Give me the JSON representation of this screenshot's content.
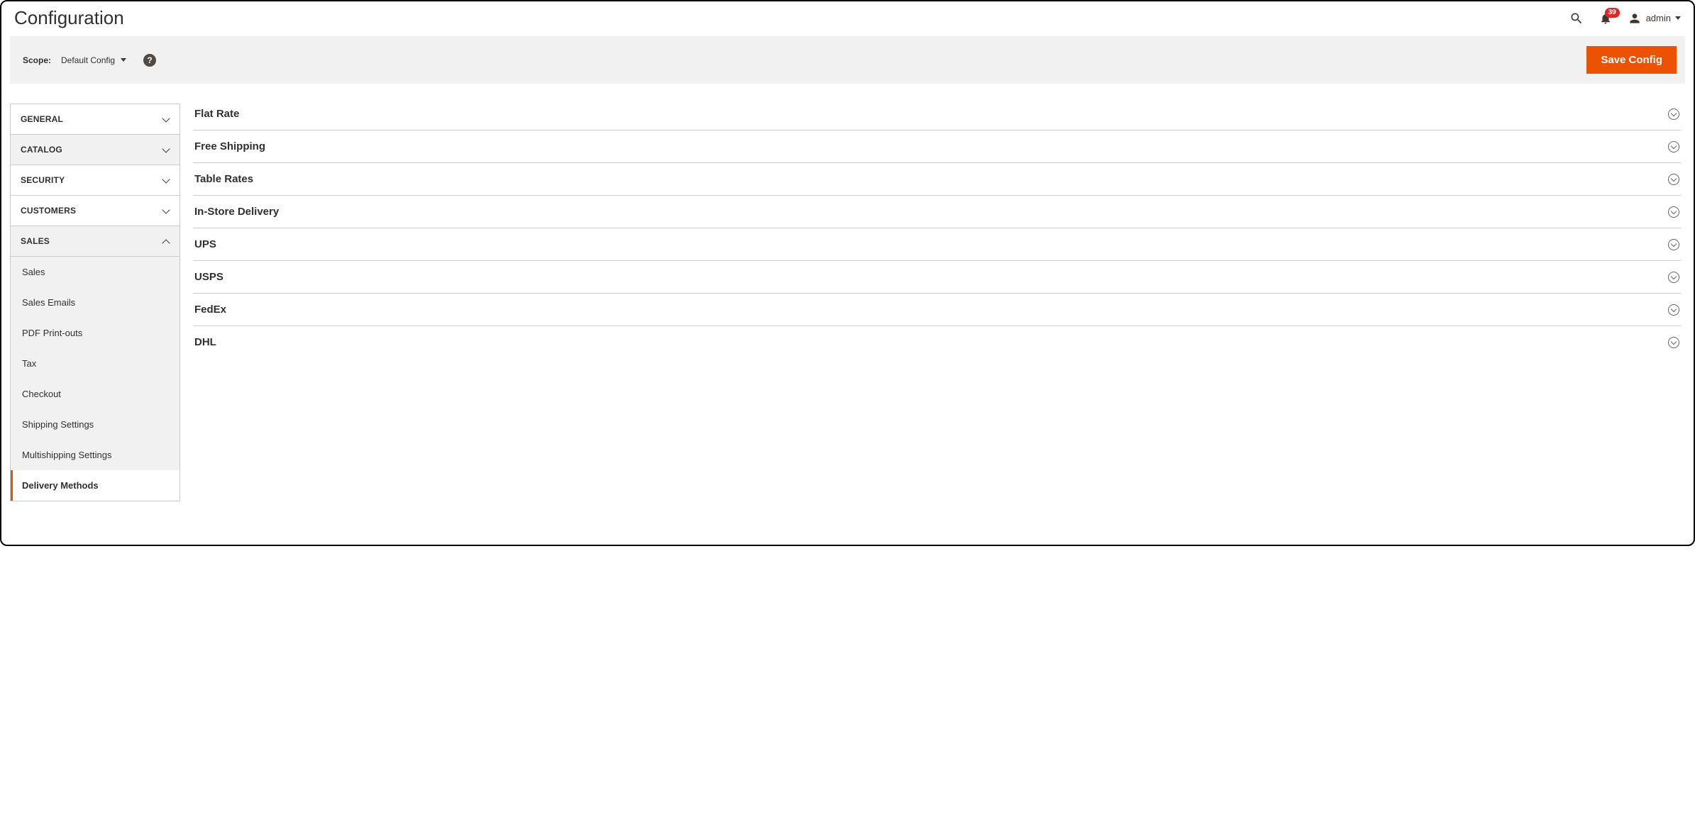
{
  "page": {
    "title": "Configuration"
  },
  "header": {
    "notification_count": "39",
    "user_name": "admin"
  },
  "scope": {
    "label": "Scope:",
    "selected": "Default Config",
    "save_label": "Save Config"
  },
  "sidebar": {
    "tabs": [
      {
        "label": "GENERAL",
        "expanded": false,
        "shaded": false
      },
      {
        "label": "CATALOG",
        "expanded": false,
        "shaded": true
      },
      {
        "label": "SECURITY",
        "expanded": false,
        "shaded": false
      },
      {
        "label": "CUSTOMERS",
        "expanded": false,
        "shaded": false
      },
      {
        "label": "SALES",
        "expanded": true,
        "shaded": true
      }
    ],
    "sales_items": [
      {
        "label": "Sales",
        "active": false
      },
      {
        "label": "Sales Emails",
        "active": false
      },
      {
        "label": "PDF Print-outs",
        "active": false
      },
      {
        "label": "Tax",
        "active": false
      },
      {
        "label": "Checkout",
        "active": false
      },
      {
        "label": "Shipping Settings",
        "active": false
      },
      {
        "label": "Multishipping Settings",
        "active": false
      },
      {
        "label": "Delivery Methods",
        "active": true
      }
    ]
  },
  "main": {
    "sections": [
      {
        "title": "Flat Rate"
      },
      {
        "title": "Free Shipping"
      },
      {
        "title": "Table Rates"
      },
      {
        "title": "In-Store Delivery"
      },
      {
        "title": "UPS"
      },
      {
        "title": "USPS"
      },
      {
        "title": "FedEx"
      },
      {
        "title": "DHL"
      }
    ]
  }
}
